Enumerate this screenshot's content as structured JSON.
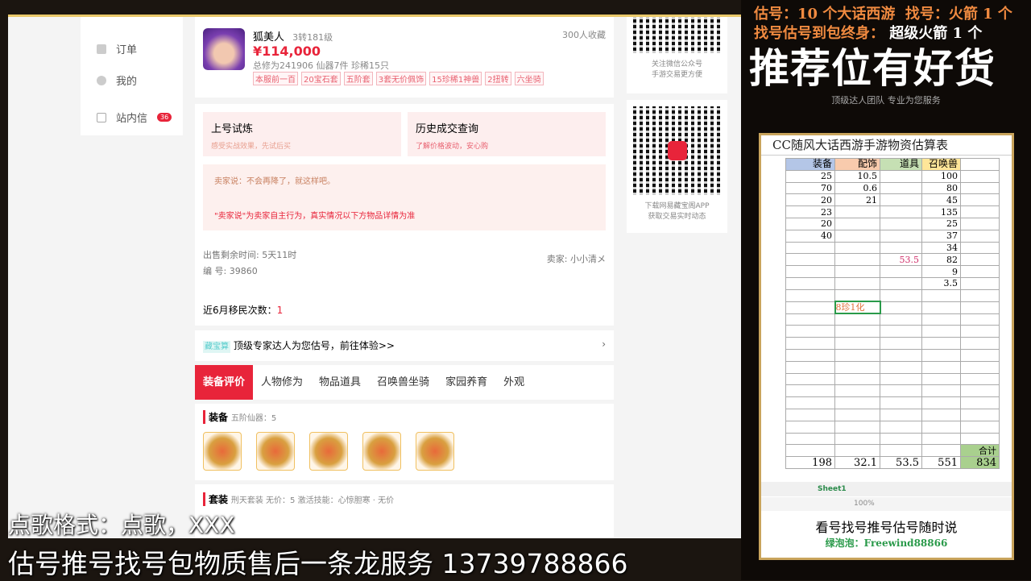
{
  "sidebar": {
    "items": [
      {
        "label": "订单"
      },
      {
        "label": "我的"
      }
    ],
    "inbox": {
      "label": "站内信",
      "count": "36"
    }
  },
  "listing": {
    "name": "狐美人",
    "level": "3转181级",
    "favorites": "300人收藏",
    "price": "¥114,000",
    "stats": "总修为241906  仙器7件  珍稀15只",
    "tags": [
      "本服前一百",
      "20宝石套",
      "五阶套",
      "3套无价佩饰",
      "15珍稀1神兽",
      "2扭转",
      "六坐骑"
    ]
  },
  "actions": [
    {
      "title": "上号试炼",
      "sub": "感受实战效果，先试后买"
    },
    {
      "title": "历史成交查询",
      "sub": "了解价格波动，安心购"
    }
  ],
  "seller_note": {
    "text": "卖家说：不会再降了，就这样吧。",
    "disclaimer": "\"卖家说\"为卖家自主行为，真实情况以下方物品详情为准"
  },
  "meta": {
    "time_left": "出售剩余时间: 5天11时",
    "seller": "卖家: 小小清メ",
    "id": "编 号: 39860"
  },
  "migration": {
    "label": "近6月移民次数：",
    "value": "1"
  },
  "appraise": {
    "badge": "藏宝算",
    "text": "顶级专家达人为您估号，前往体验>>"
  },
  "tabs": [
    "装备评价",
    "人物修为",
    "物品道具",
    "召唤兽坐骑",
    "家园养育",
    "外观"
  ],
  "equip": {
    "title": "装备",
    "sub": "五阶仙器：5"
  },
  "suit": {
    "title": "套装",
    "sub": "刑天套装  无价：5  激活技能：心惊胆寒 · 无价"
  },
  "qr": [
    {
      "caption1": "关注微信公众号",
      "caption2": "手游交易更方便"
    },
    {
      "caption1": "下载网易藏宝阁APP",
      "caption2": "获取交易实时动态"
    }
  ],
  "promo": {
    "line1a": "估号：10 个大话西游",
    "line1b": "找号：火箭 1 个",
    "line2a": "找号估号到包终身：",
    "line2b": "超级火箭 1 个",
    "big": "推荐位有好货",
    "sub": "顶级达人团队 专业为您服务"
  },
  "sheet": {
    "title": "CC随风大话西游手游物资估算表",
    "headers": [
      "装备",
      "配饰",
      "道具",
      "召唤兽",
      ""
    ],
    "rows": [
      [
        "25",
        "10.5",
        "",
        "100",
        ""
      ],
      [
        "70",
        "0.6",
        "",
        "80",
        ""
      ],
      [
        "20",
        "21",
        "",
        "45",
        ""
      ],
      [
        "23",
        "",
        "",
        "135",
        ""
      ],
      [
        "20",
        "",
        "",
        "25",
        ""
      ],
      [
        "40",
        "",
        "",
        "37",
        ""
      ],
      [
        "",
        "",
        "",
        "34",
        ""
      ],
      [
        "",
        "",
        "53.5",
        "82",
        ""
      ],
      [
        "",
        "",
        "",
        "9",
        ""
      ],
      [
        "",
        "",
        "",
        "3.5",
        ""
      ],
      [
        "",
        "",
        "",
        "",
        ""
      ],
      [
        "",
        "8珍1化",
        "",
        "",
        ""
      ]
    ],
    "total_label": "合计",
    "totals": [
      "198",
      "32.1",
      "53.5",
      "551",
      "834"
    ],
    "tab": "Sheet1",
    "zoom": "100%",
    "footer1": "看号找号推号估号随时说",
    "footer2": "绿泡泡：Freewind88866",
    "colors": {
      "c0": "#b4c6e7",
      "c1": "#f8cbad",
      "c2": "#c6e0b4",
      "c3": "#ffe699"
    }
  },
  "overlay": {
    "song": "点歌格式：点歌，XXX",
    "service": "估号推号找号包物质售后一条龙服务 13739788866"
  }
}
